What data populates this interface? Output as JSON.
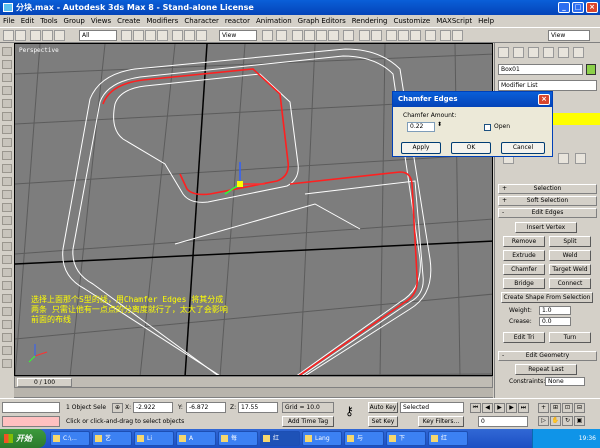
{
  "window": {
    "title": "分块.max - Autodesk 3ds Max 8 - Stand-alone License",
    "min_label": "_",
    "max_label": "□",
    "close_label": "×"
  },
  "menubar": [
    "File",
    "Edit",
    "Tools",
    "Group",
    "Views",
    "Create",
    "Modifiers",
    "Character",
    "reactor",
    "Animation",
    "Graph Editors",
    "Rendering",
    "Customize",
    "MAXScript",
    "Help"
  ],
  "toolbar": {
    "selection_filter": "All",
    "ref_coord": "View",
    "named_selection": "View"
  },
  "viewport": {
    "label": "Perspective",
    "background": "#7d7d7d",
    "annotation": "选择上面那个S型的线，用Chamfer Edges 将其分成两条 只需让他有一点点的分离度就行了，太大了会影响前面的布线"
  },
  "dialog": {
    "title": "Chamfer Edges",
    "amount_label": "Chamfer Amount:",
    "amount_value": "0.22",
    "open_label": "Open",
    "apply_label": "Apply",
    "ok_label": "OK",
    "cancel_label": "Cancel"
  },
  "command_panel": {
    "object_name": "Box01",
    "modifier_list": "Modifier List",
    "rollouts": {
      "selection": "Selection",
      "soft_selection": "Soft Selection",
      "edit_edges": "Edit Edges",
      "edit_geometry": "Edit Geometry"
    },
    "buttons": {
      "insert_vertex": "Insert Vertex",
      "remove": "Remove",
      "split": "Split",
      "extrude": "Extrude",
      "weld": "Weld",
      "chamfer": "Chamfer",
      "target_weld": "Target Weld",
      "bridge": "Bridge",
      "connect": "Connect",
      "create_shape": "Create Shape From Selection",
      "edit_tri": "Edit Tri",
      "turn": "Turn",
      "repeat_last": "Repeat Last"
    },
    "weight_label": "Weight:",
    "weight_value": "1.0",
    "crease_label": "Crease:",
    "crease_value": "0.0",
    "constraints_label": "Constraints:",
    "constraints_value": "None"
  },
  "timeline": {
    "frame": "0 / 100"
  },
  "status": {
    "selection_count": "1 Object Sele",
    "x_label": "X:",
    "x_value": "-2.922",
    "y_label": "Y:",
    "y_value": "-6.872",
    "z_label": "Z:",
    "z_value": "17.55",
    "grid": "Grid = 10.0",
    "auto_key": "Auto Key",
    "set_key": "Set Key",
    "selected": "Selected",
    "key_filters": "Key Filters...",
    "prompt": "Click or click-and-drag to select objects",
    "add_time_tag": "Add Time Tag",
    "current_frame": "0"
  },
  "taskbar": {
    "start_label": "开始",
    "tasks": [
      "C:\\...",
      "艺",
      "Li",
      "A",
      "每",
      "红",
      "Lang",
      "与",
      "下",
      "红"
    ],
    "clock": "19:36"
  },
  "colors": {
    "title_blue": "#0a5fd8",
    "viewport_gray": "#7d7d7d",
    "annotation_yellow": "#ffff00",
    "selected_edge_red": "#ff2020",
    "object_color": "#8cd04a"
  }
}
